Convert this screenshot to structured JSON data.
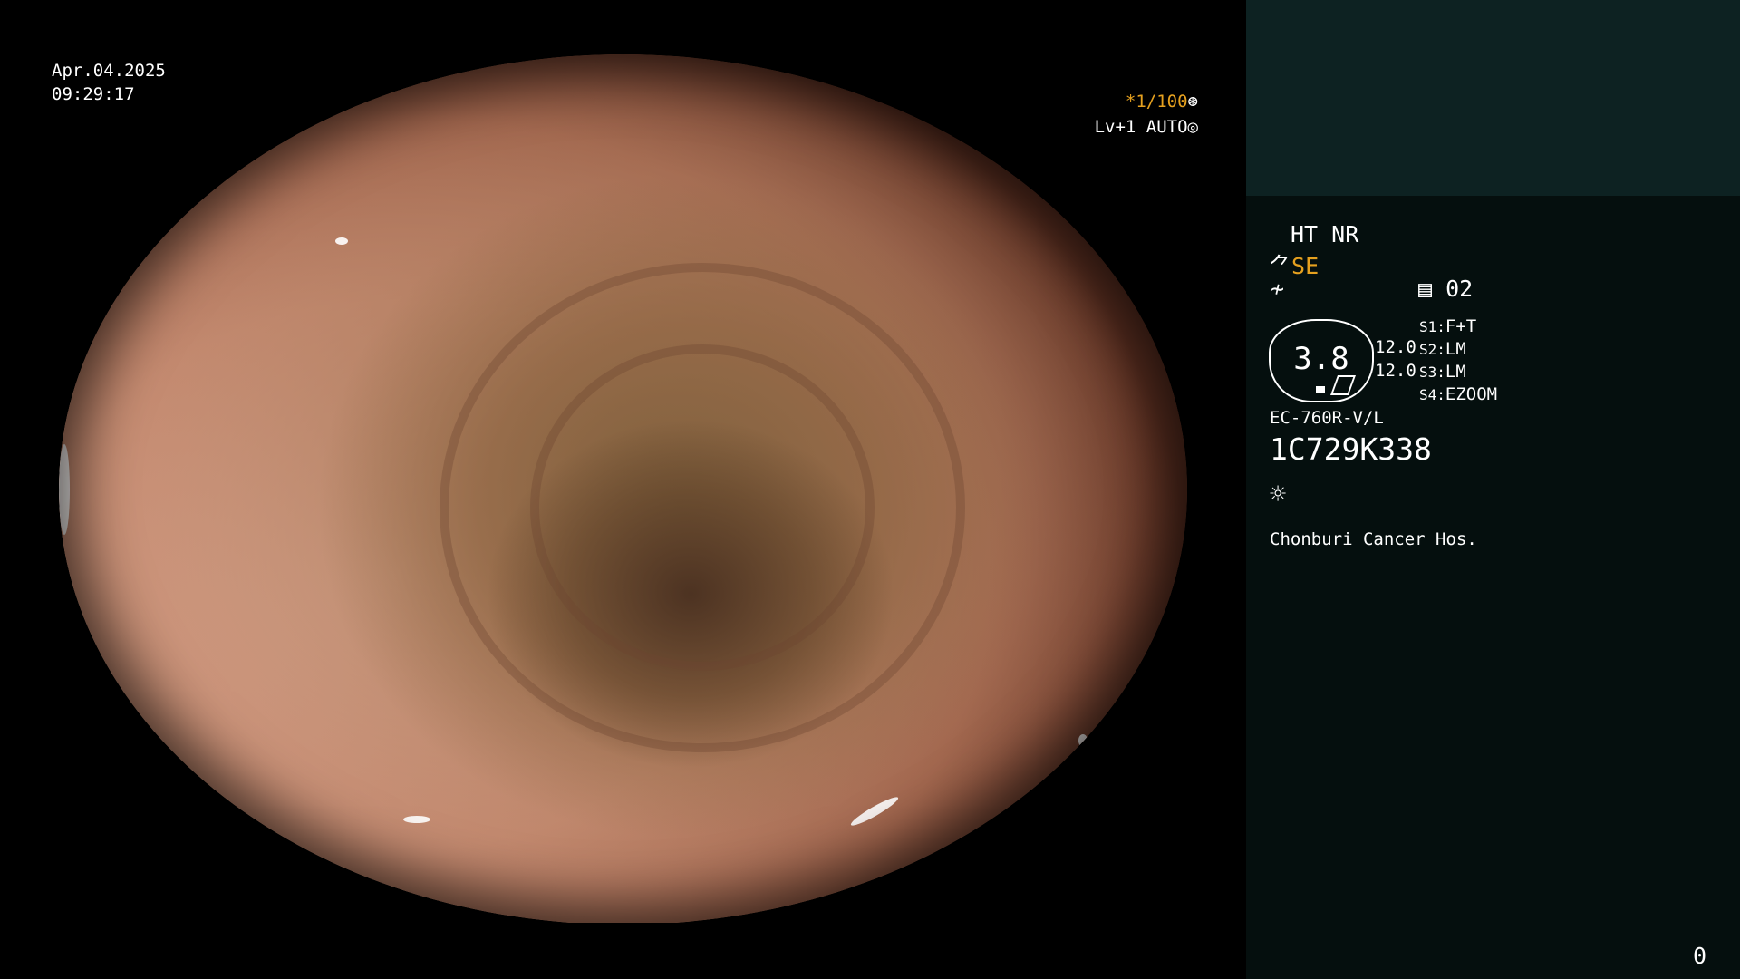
{
  "overlay": {
    "date": "Apr.04.2025",
    "time": "09:29:17",
    "shutter": "*1/100",
    "shutter_icon": "⊛",
    "level_mode": "Lv+1 AUTO",
    "level_icon": "◎"
  },
  "panel": {
    "ht_nr": "HT NR",
    "se_label": "SE",
    "se_icon": "⺈",
    "f_icon": "≁",
    "page_icon": "▤",
    "page_value": "02",
    "zoom_value": "3.8",
    "value_top": "12.0",
    "value_bottom": "12.0",
    "switches": [
      {
        "key": "S1:",
        "value": "F+T"
      },
      {
        "key": "S2:",
        "value": "LM"
      },
      {
        "key": "S3:",
        "value": "LM"
      },
      {
        "key": "S4:",
        "value": "EZOOM"
      }
    ],
    "scope_model": "EC-760R-V/L",
    "serial": "1C729K338",
    "light_icon": "☼",
    "hospital": "Chonburi Cancer Hos.",
    "corner_number": "0"
  },
  "colors": {
    "accent_orange": "#e6a11f",
    "panel_bg": "#050f0e",
    "panel_top_bg": "#0d2222"
  }
}
